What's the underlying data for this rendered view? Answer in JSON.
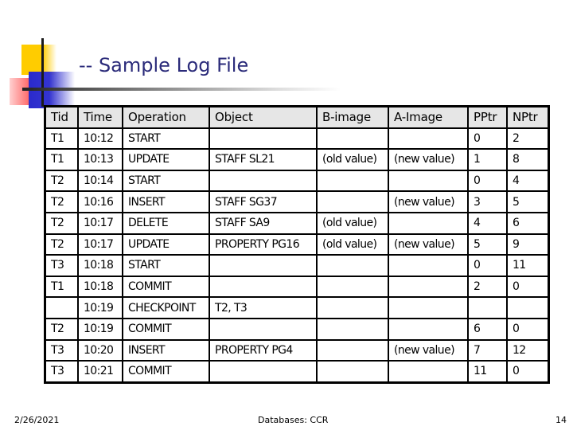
{
  "slide": {
    "title": "-- Sample Log File",
    "footer": {
      "date": "2/26/2021",
      "center": "Databases: CCR",
      "page_number": "14"
    }
  },
  "log_table": {
    "headers": [
      "Tid",
      "Time",
      "Operation",
      "Object",
      "B-image",
      "A-Image",
      "PPtr",
      "NPtr"
    ],
    "rows": [
      [
        "T1",
        "10:12",
        "START",
        "",
        "",
        "",
        "0",
        "2"
      ],
      [
        "T1",
        "10:13",
        "UPDATE",
        "STAFF SL21",
        "(old value)",
        "(new value)",
        "1",
        "8"
      ],
      [
        "T2",
        "10:14",
        "START",
        "",
        "",
        "",
        "0",
        "4"
      ],
      [
        "T2",
        "10:16",
        "INSERT",
        "STAFF SG37",
        "",
        "(new value)",
        "3",
        "5"
      ],
      [
        "T2",
        "10:17",
        "DELETE",
        "STAFF SA9",
        "(old value)",
        "",
        "4",
        "6"
      ],
      [
        "T2",
        "10:17",
        "UPDATE",
        "PROPERTY PG16",
        "(old value)",
        "(new value)",
        "5",
        "9"
      ],
      [
        "T3",
        "10:18",
        "START",
        "",
        "",
        "",
        "0",
        "11"
      ],
      [
        "T1",
        "10:18",
        "COMMIT",
        "",
        "",
        "",
        "2",
        "0"
      ],
      [
        "",
        "10:19",
        "CHECKPOINT",
        "T2, T3",
        "",
        "",
        "",
        ""
      ],
      [
        "T2",
        "10:19",
        "COMMIT",
        "",
        "",
        "",
        "6",
        "0"
      ],
      [
        "T3",
        "10:20",
        "INSERT",
        "PROPERTY PG4",
        "",
        "(new value)",
        "7",
        "12"
      ],
      [
        "T3",
        "10:21",
        "COMMIT",
        "",
        "",
        "",
        "11",
        "0"
      ]
    ]
  },
  "colors": {
    "title": "#2b2b7a",
    "header_bg": "#e6e6e6",
    "accent_yellow": "#ffcc00",
    "accent_blue": "#3434d0",
    "accent_red": "#ff5050"
  }
}
